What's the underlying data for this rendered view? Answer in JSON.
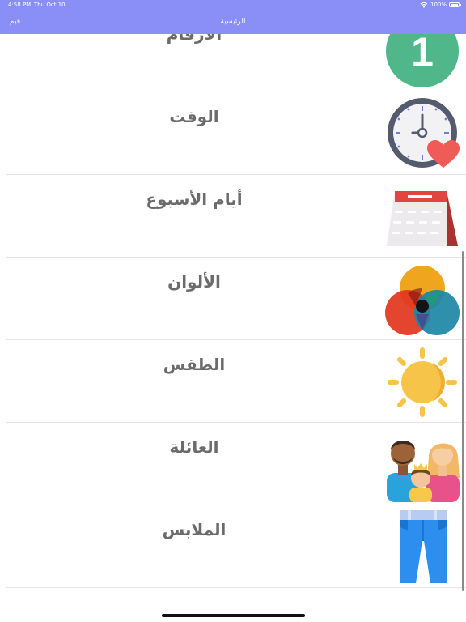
{
  "status": {
    "time": "4:58 PM",
    "date": "Thu Oct 10",
    "battery": "100%"
  },
  "nav": {
    "title": "الرئيسية",
    "left_button": "قيم"
  },
  "items": [
    {
      "label": "الأرقام",
      "icon": "number-one-icon"
    },
    {
      "label": "الوقت",
      "icon": "clock-heart-icon"
    },
    {
      "label": "أيام الأسبوع",
      "icon": "calendar-icon"
    },
    {
      "label": "الألوان",
      "icon": "color-circles-icon"
    },
    {
      "label": "الطقس",
      "icon": "sun-icon"
    },
    {
      "label": "العائلة",
      "icon": "family-icon"
    },
    {
      "label": "الملابس",
      "icon": "jeans-icon"
    }
  ],
  "icon_text": {
    "number": "1"
  },
  "colors": {
    "navbar": "#8a8ff7",
    "label": "#6b6b6b",
    "separator": "#e4e4e4"
  }
}
